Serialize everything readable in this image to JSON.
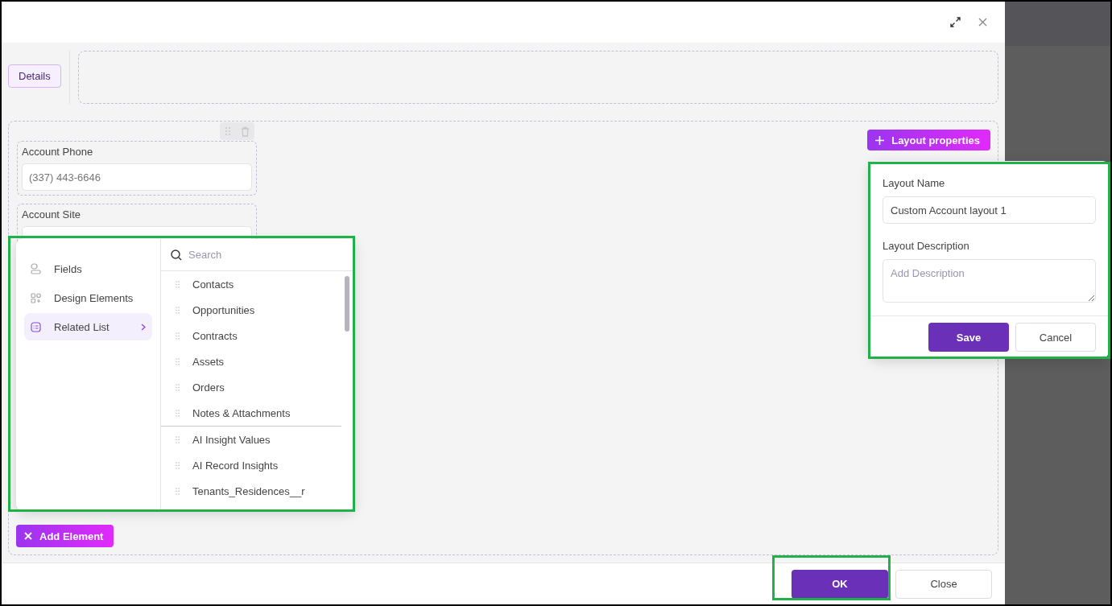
{
  "tabs": [
    {
      "label": "Details",
      "selected": true
    }
  ],
  "fields": [
    {
      "label": "Account Phone",
      "value": "(337) 443-6646"
    },
    {
      "label": "Account Site"
    }
  ],
  "layout_properties_button": "Layout properties",
  "add_element_button": "Add Element",
  "element_picker": {
    "categories": [
      {
        "label": "Fields",
        "kind": "fields",
        "selected": false
      },
      {
        "label": "Design Elements",
        "kind": "design",
        "selected": false
      },
      {
        "label": "Related List",
        "kind": "related",
        "selected": true
      }
    ],
    "search": {
      "placeholder": "Search"
    },
    "groups": [
      [
        "Contacts",
        "Opportunities",
        "Contracts",
        "Assets",
        "Orders",
        "Notes & Attachments"
      ],
      [
        "AI Insight Values",
        "AI Record Insights",
        "Tenants_Residences__r"
      ]
    ]
  },
  "layout_panel": {
    "name_label": "Layout Name",
    "name_value": "Custom Account layout 1",
    "description_label": "Layout Description",
    "description_placeholder": "Add Description",
    "buttons": [
      {
        "label": "Save",
        "kind": "primary"
      },
      {
        "label": "Cancel",
        "kind": "secondary"
      }
    ]
  },
  "footer_buttons": [
    {
      "label": "OK",
      "kind": "primary"
    },
    {
      "label": "Close",
      "kind": "secondary"
    }
  ]
}
